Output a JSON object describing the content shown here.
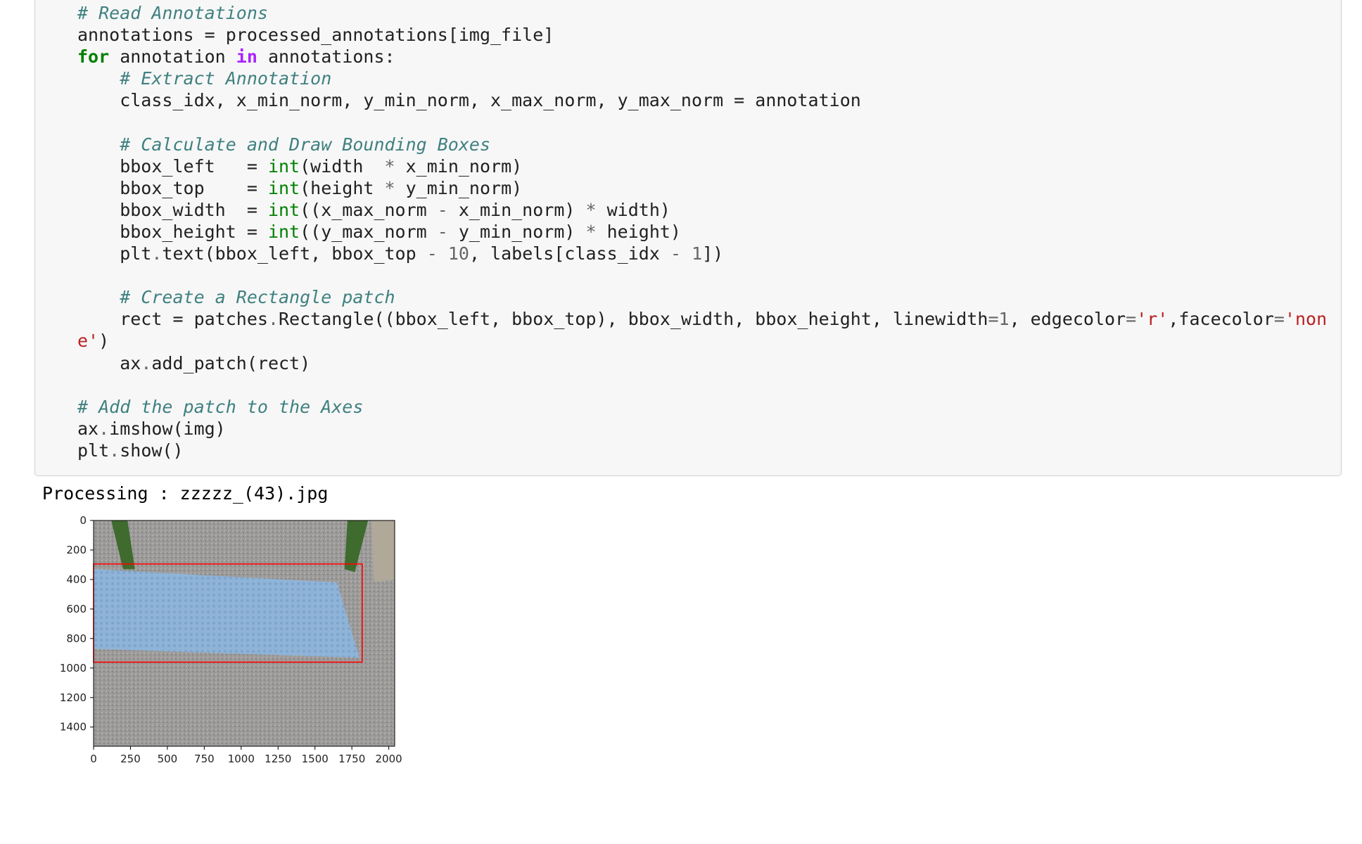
{
  "code_lines": [
    [
      {
        "t": "cm",
        "v": "# Read Annotations"
      }
    ],
    [
      {
        "t": "",
        "v": "annotations = processed_annotations[img_file]"
      }
    ],
    [
      {
        "t": "kw",
        "v": "for"
      },
      {
        "t": "",
        "v": " annotation "
      },
      {
        "t": "kwn",
        "v": "in"
      },
      {
        "t": "",
        "v": " annotations:"
      }
    ],
    [
      {
        "t": "",
        "v": "    "
      },
      {
        "t": "cm",
        "v": "# Extract Annotation"
      }
    ],
    [
      {
        "t": "",
        "v": "    class_idx, x_min_norm, y_min_norm, x_max_norm, y_max_norm = annotation"
      }
    ],
    [
      {
        "t": "",
        "v": ""
      }
    ],
    [
      {
        "t": "",
        "v": "    "
      },
      {
        "t": "cm",
        "v": "# Calculate and Draw Bounding Boxes"
      }
    ],
    [
      {
        "t": "",
        "v": "    bbox_left   = "
      },
      {
        "t": "bi",
        "v": "int"
      },
      {
        "t": "",
        "v": "(width  "
      },
      {
        "t": "op",
        "v": "*"
      },
      {
        "t": "",
        "v": " x_min_norm)"
      }
    ],
    [
      {
        "t": "",
        "v": "    bbox_top    = "
      },
      {
        "t": "bi",
        "v": "int"
      },
      {
        "t": "",
        "v": "(height "
      },
      {
        "t": "op",
        "v": "*"
      },
      {
        "t": "",
        "v": " y_min_norm)"
      }
    ],
    [
      {
        "t": "",
        "v": "    bbox_width  = "
      },
      {
        "t": "bi",
        "v": "int"
      },
      {
        "t": "",
        "v": "((x_max_norm "
      },
      {
        "t": "op",
        "v": "-"
      },
      {
        "t": "",
        "v": " x_min_norm) "
      },
      {
        "t": "op",
        "v": "*"
      },
      {
        "t": "",
        "v": " width)"
      }
    ],
    [
      {
        "t": "",
        "v": "    bbox_height = "
      },
      {
        "t": "bi",
        "v": "int"
      },
      {
        "t": "",
        "v": "((y_max_norm "
      },
      {
        "t": "op",
        "v": "-"
      },
      {
        "t": "",
        "v": " y_min_norm) "
      },
      {
        "t": "op",
        "v": "*"
      },
      {
        "t": "",
        "v": " height)"
      }
    ],
    [
      {
        "t": "",
        "v": "    plt"
      },
      {
        "t": "op",
        "v": "."
      },
      {
        "t": "",
        "v": "text(bbox_left, bbox_top "
      },
      {
        "t": "op",
        "v": "-"
      },
      {
        "t": "",
        "v": " "
      },
      {
        "t": "nu",
        "v": "10"
      },
      {
        "t": "",
        "v": ", labels[class_idx "
      },
      {
        "t": "op",
        "v": "-"
      },
      {
        "t": "",
        "v": " "
      },
      {
        "t": "nu",
        "v": "1"
      },
      {
        "t": "",
        "v": "])"
      }
    ],
    [
      {
        "t": "",
        "v": ""
      }
    ],
    [
      {
        "t": "",
        "v": "    "
      },
      {
        "t": "cm",
        "v": "# Create a Rectangle patch"
      }
    ],
    [
      {
        "t": "",
        "v": "    rect = patches"
      },
      {
        "t": "op",
        "v": "."
      },
      {
        "t": "",
        "v": "Rectangle((bbox_left, bbox_top), bbox_width, bbox_height, linewidth"
      },
      {
        "t": "op",
        "v": "="
      },
      {
        "t": "nu",
        "v": "1"
      },
      {
        "t": "",
        "v": ", edgecolor"
      },
      {
        "t": "op",
        "v": "="
      },
      {
        "t": "st",
        "v": "'r'"
      },
      {
        "t": "",
        "v": ",facecolor"
      },
      {
        "t": "op",
        "v": "="
      },
      {
        "t": "st",
        "v": "'non"
      }
    ],
    [
      {
        "t": "st",
        "v": "e'"
      },
      {
        "t": "",
        "v": ")"
      }
    ],
    [
      {
        "t": "",
        "v": "    ax"
      },
      {
        "t": "op",
        "v": "."
      },
      {
        "t": "",
        "v": "add_patch(rect)"
      }
    ],
    [
      {
        "t": "",
        "v": ""
      }
    ],
    [
      {
        "t": "cm",
        "v": "# Add the patch to the Axes"
      }
    ],
    [
      {
        "t": "",
        "v": "ax"
      },
      {
        "t": "op",
        "v": "."
      },
      {
        "t": "",
        "v": "imshow(img)"
      }
    ],
    [
      {
        "t": "",
        "v": "plt"
      },
      {
        "t": "op",
        "v": "."
      },
      {
        "t": "",
        "v": "show()"
      }
    ]
  ],
  "output": {
    "text": "Processing : zzzzz_(43).jpg"
  },
  "plot": {
    "x_ticks": [
      "0",
      "250",
      "500",
      "750",
      "1000",
      "1250",
      "1500",
      "1750",
      "2000"
    ],
    "y_ticks": [
      "0",
      "200",
      "400",
      "600",
      "800",
      "1000",
      "1200",
      "1400"
    ],
    "x_range": [
      0,
      2040
    ],
    "y_range": [
      0,
      1530
    ],
    "bbox": {
      "x_min": 0,
      "y_min": 295,
      "x_max": 1820,
      "y_max": 960,
      "edgecolor": "#ff0000"
    },
    "colors": {
      "ground": "#9b9a99",
      "tile": "#8fb4d8",
      "rail": "#3f6b2e"
    }
  }
}
